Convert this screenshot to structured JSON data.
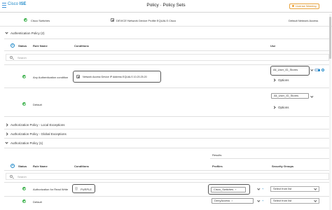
{
  "header": {
    "brand_prefix": "Cisco",
    "brand_name": "ISE",
    "title": "Policy · Policy Sets",
    "eval_badge": "License Warning"
  },
  "policy_set": {
    "name": "Cisco Switches",
    "condition": "DEVICE·Network Device Profile EQUALS Cisco",
    "allowed_protocols": "Default Network Access"
  },
  "authentication_policy": {
    "title": "Authentication Policy (2)",
    "columns": {
      "status": "Status",
      "rule_name": "Rule Name",
      "conditions": "Conditions",
      "use": "Use"
    },
    "search_placeholder": "Search",
    "rules": [
      {
        "name": "Any Authentication condition",
        "condition": "Network Access·Device IP Address EQUALS 10.20.25.20",
        "use": "All_User_ID_Stores",
        "options": "Options"
      },
      {
        "name": "Default",
        "condition": "",
        "use": "All_User_ID_Stores",
        "options": "Options"
      }
    ]
  },
  "collapsed_sections": [
    "Authorization Policy - Local Exceptions",
    "Authorization Policy - Global Exceptions"
  ],
  "authorization_policy": {
    "title": "Authorization Policy (1)",
    "results_label": "Results",
    "columns": {
      "status": "Status",
      "rule_name": "Rule Name",
      "conditions": "Conditions",
      "profiles": "Profiles",
      "security_groups": "Security Groups"
    },
    "search_placeholder": "Search",
    "rules": [
      {
        "name": "Authorization for Read Write",
        "condition": "PURPLE",
        "profile": "Cisco_Switches",
        "security_group": "Select from list"
      },
      {
        "name": "Default",
        "condition": "",
        "profile": "DenyAccess",
        "security_group": "Select from list"
      }
    ]
  },
  "icons": {
    "menu": "hamburger-icon",
    "status": "check-circle-icon",
    "add": "plus-circle-icon",
    "search": "search-icon",
    "condition": "condition-icon",
    "toggle": "toggle-icon"
  },
  "colors": {
    "accent": "#1a86c7",
    "status_ok": "#3bb14b",
    "warning": "#e8a33c"
  }
}
